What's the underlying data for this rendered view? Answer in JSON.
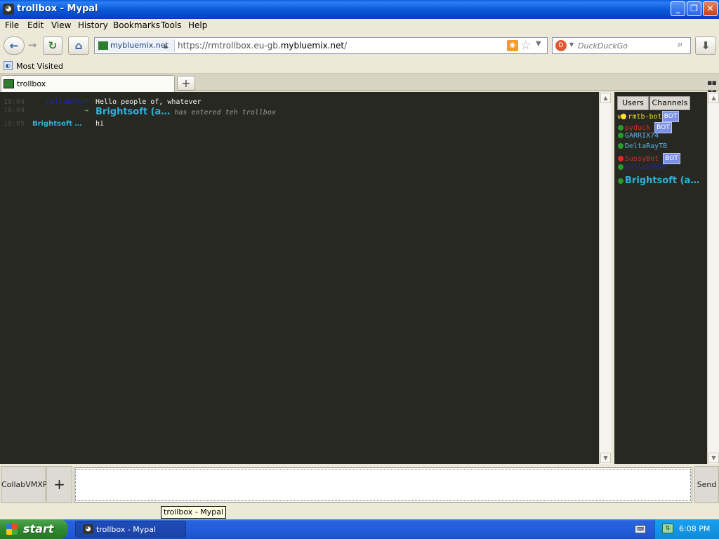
{
  "window": {
    "title": "trollbox - Mypal"
  },
  "menu": [
    "File",
    "Edit",
    "View",
    "History",
    "Bookmarks",
    "Tools",
    "Help"
  ],
  "nav": {
    "site_name": "mybluemix.net",
    "url_prefix": "https://rmtrollbox.eu-gb.",
    "url_domain": "mybluemix.net",
    "url_suffix": "/",
    "search_placeholder": "DuckDuckGo"
  },
  "bookmarks": {
    "most_visited": "Most Visited"
  },
  "tabs": [
    {
      "label": "trollbox"
    }
  ],
  "chat": {
    "messages": [
      {
        "time": "18:04",
        "nick": "CollabVMXP",
        "nick_color": "#1e2a9e",
        "text": "Hello people of, whatever"
      },
      {
        "time": "18:04",
        "nick": "→",
        "nick_color": "#3fcf3f",
        "join_nick": "Brightsoft (a…",
        "text": "has entered teh trollbox"
      },
      {
        "time": "18:05",
        "nick": "Brightsoft …",
        "nick_color": "#2fb0d8",
        "text": "hi"
      }
    ]
  },
  "sidebar": {
    "tab_users": "Users",
    "tab_channels": "Channels",
    "users": [
      {
        "name": "rmtb-bot",
        "color": "#e6db3a",
        "dot": "#ffe12a",
        "badge": "BOT",
        "crown": true
      },
      {
        "name": "pyduck",
        "color": "#e02a2a",
        "dot": "#2a9a2a",
        "badge": "BOT"
      },
      {
        "name": "GARRIX74",
        "color": "#56b4e0",
        "dot": "#2a9a2a",
        "badge": ""
      },
      {
        "name": "DeltaRayTB",
        "color": "#56b4e0",
        "dot": "#2a9a2a",
        "badge": ""
      },
      {
        "name": "SussyBot",
        "color": "#d23030",
        "dot": "#e02a2a",
        "badge": "BOT"
      },
      {
        "name": "CollabVMXP",
        "color": "#1e2a9e",
        "dot": "#2a9a2a",
        "badge": ""
      },
      {
        "name": "Brightsoft (a…",
        "color": "#2fb0d8",
        "dot": "#2a9a2a",
        "badge": ""
      }
    ]
  },
  "input": {
    "channel_label": "CollabVMXP",
    "add_label": "+",
    "value": "",
    "send_label": "Send"
  },
  "tooltip": "trollbox - Mypal",
  "taskbar": {
    "start_label": "start",
    "item_label": "trollbox - Mypal",
    "clock": "6:08 PM"
  }
}
